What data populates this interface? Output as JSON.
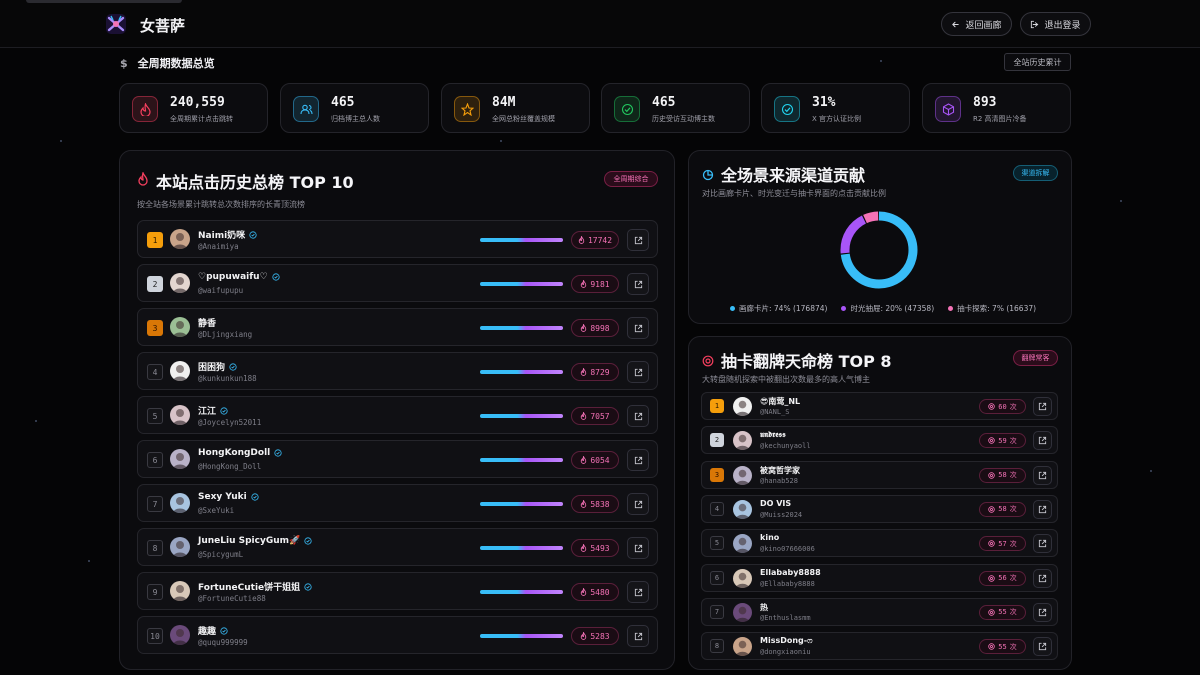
{
  "header": {
    "brand": "女菩萨",
    "back_label": "返回画廊",
    "logout_label": "退出登录"
  },
  "overview": {
    "title": "全周期数据总览",
    "tag": "全站历史累计",
    "stats": [
      {
        "value": "240,559",
        "label": "全周期累计点击跳转",
        "icon": "flame-icon",
        "color": "#f43f5e"
      },
      {
        "value": "465",
        "label": "归档博主总人数",
        "icon": "users-icon",
        "color": "#38bdf8"
      },
      {
        "value": "84M",
        "label": "全网总粉丝覆盖规模",
        "icon": "star-icon",
        "color": "#f59e0b"
      },
      {
        "value": "465",
        "label": "历史受访互动博主数",
        "icon": "check-circle-icon",
        "color": "#22c55e"
      },
      {
        "value": "31%",
        "label": "X 官方认证比例",
        "icon": "badge-check-icon",
        "color": "#22d3ee"
      },
      {
        "value": "893",
        "label": "R2 高清图片冷备",
        "icon": "cube-icon",
        "color": "#a855f7"
      }
    ]
  },
  "top10": {
    "title": "本站点击历史总榜 TOP 10",
    "subtitle": "按全站各场景累计跳转总次数排序的长青顶流榜",
    "badge": "全周期综合",
    "rows": [
      {
        "rank": "1",
        "name": "Naimi奶咪",
        "handle": "@Anaimiya",
        "clicks": "17742",
        "verified": true
      },
      {
        "rank": "2",
        "name": "♡pupuwaifu♡",
        "handle": "@waifupupu",
        "clicks": "9181",
        "verified": true
      },
      {
        "rank": "3",
        "name": "静香",
        "handle": "@DLjingxiang",
        "clicks": "8998",
        "verified": false
      },
      {
        "rank": "4",
        "name": "困困狗",
        "handle": "@kunkunkun188",
        "clicks": "8729",
        "verified": true
      },
      {
        "rank": "5",
        "name": "江江",
        "handle": "@Joycelyn52011",
        "clicks": "7057",
        "verified": true
      },
      {
        "rank": "6",
        "name": "HongKongDoll",
        "handle": "@HongKong_Doll",
        "clicks": "6054",
        "verified": true
      },
      {
        "rank": "7",
        "name": "Sexy Yuki",
        "handle": "@SxeYuki",
        "clicks": "5838",
        "verified": true
      },
      {
        "rank": "8",
        "name": "JuneLiu SpicyGum🚀",
        "handle": "@SpicygumL",
        "clicks": "5493",
        "verified": true
      },
      {
        "rank": "9",
        "name": "FortuneCutie饼干姐姐",
        "handle": "@FortuneCutie88",
        "clicks": "5480",
        "verified": true
      },
      {
        "rank": "10",
        "name": "趣趣",
        "handle": "@ququ999999",
        "clicks": "5283",
        "verified": true
      }
    ]
  },
  "sources": {
    "title": "全场景来源渠道贡献",
    "subtitle": "对比画廊卡片、时光变迁与抽卡界面的点击贡献比例",
    "badge": "渠道拆解",
    "legend": [
      "画廊卡片: 74% (176874)",
      "时光抽屉: 20% (47358)",
      "抽卡探索: 7% (16637)"
    ]
  },
  "chart_data": {
    "type": "pie",
    "categories": [
      "画廊卡片",
      "时光抽屉",
      "抽卡探索"
    ],
    "values": [
      176874,
      47358,
      16637
    ],
    "percent": [
      74,
      20,
      7
    ],
    "colors": [
      "#38bdf8",
      "#a855f7",
      "#f472b6"
    ]
  },
  "gacha": {
    "title": "抽卡翻牌天命榜 TOP 8",
    "subtitle": "大转盘随机探索中被翻出次数最多的高人气博主",
    "badge": "翻牌常客",
    "unit": "次",
    "rows": [
      {
        "rank": "1",
        "name": "😎南莺_NL",
        "handle": "@NANL_S",
        "count": "60"
      },
      {
        "rank": "2",
        "name": "𝖚𝖓𝖉𝖗𝖊𝖘𝖘",
        "handle": "@kechunyaoll",
        "count": "59"
      },
      {
        "rank": "3",
        "name": "被窝哲学家",
        "handle": "@hanab528",
        "count": "58"
      },
      {
        "rank": "4",
        "name": "DO VIS",
        "handle": "@Muiss2024",
        "count": "58"
      },
      {
        "rank": "5",
        "name": "kino",
        "handle": "@kino07666006",
        "count": "57"
      },
      {
        "rank": "6",
        "name": "Ellababy8888",
        "handle": "@Ellababy8888",
        "count": "56"
      },
      {
        "rank": "7",
        "name": "热",
        "handle": "@Enthuslasmm",
        "count": "55"
      },
      {
        "rank": "8",
        "name": "MissDong-ෆ",
        "handle": "@dongxiaoniu",
        "count": "55"
      }
    ]
  }
}
